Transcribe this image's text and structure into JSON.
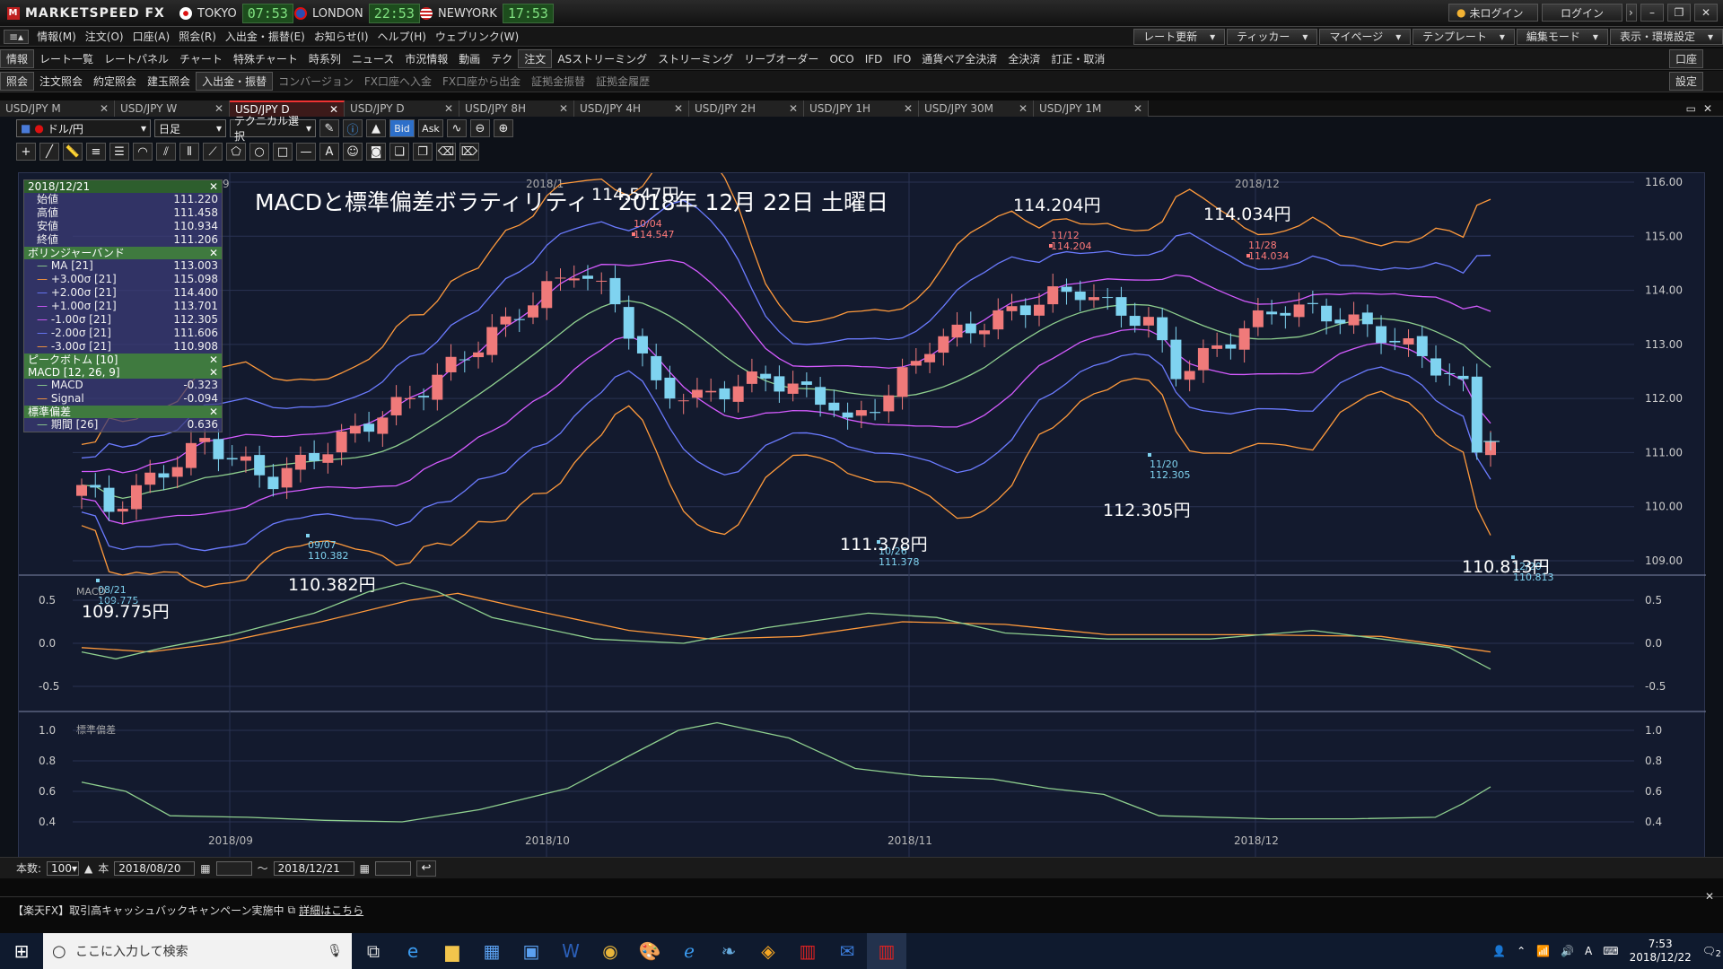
{
  "app": {
    "name": "MARKETSPEED FX",
    "login_status": "未ログイン",
    "login_button": "ログイン"
  },
  "clocks": [
    {
      "city": "TOKYO",
      "time": "07:53",
      "color": "#d11"
    },
    {
      "city": "LONDON",
      "time": "22:53",
      "color": "#2a4db3"
    },
    {
      "city": "NEWYORK",
      "time": "17:53",
      "color": "#3a5ac0"
    }
  ],
  "menu": [
    "情報(M)",
    "注文(O)",
    "口座(A)",
    "照会(R)",
    "入出金・振替(E)",
    "お知らせ(I)",
    "ヘルプ(H)",
    "ウェブリンク(W)"
  ],
  "menu_right": [
    "レート更新",
    "ティッカー",
    "マイページ",
    "テンプレート",
    "編集モード",
    "表示・環境設定"
  ],
  "toolbar1": [
    "情報",
    "レート一覧",
    "レートパネル",
    "チャート",
    "特殊チャート",
    "時系列",
    "ニュース",
    "市況情報",
    "動画",
    "テク",
    "注文",
    "ASストリーミング",
    "ストリーミング",
    "リーブオーダー",
    "OCO",
    "IFD",
    "IFO",
    "通貨ペア全決済",
    "全決済",
    "訂正・取消"
  ],
  "toolbar1_right": "口座",
  "toolbar2": [
    "照会",
    "注文照会",
    "約定照会",
    "建玉照会",
    "入出金・振替",
    "コンバージョン",
    "FX口座へ入金",
    "FX口座から出金",
    "証拠金振替",
    "証拠金履歴"
  ],
  "toolbar2_right": "設定",
  "tabs": [
    "USD/JPY M",
    "USD/JPY W",
    "USD/JPY D",
    "USD/JPY D",
    "USD/JPY 8H",
    "USD/JPY 4H",
    "USD/JPY 2H",
    "USD/JPY 1H",
    "USD/JPY 30M",
    "USD/JPY 1M"
  ],
  "chart_toolbar": {
    "pair": "ドル/円",
    "period": "日足",
    "tech": "テクニカル選択",
    "bid": "Bid",
    "ask": "Ask"
  },
  "legend": {
    "date": "2018/12/21",
    "ohlc": [
      {
        "k": "始値",
        "v": "111.220"
      },
      {
        "k": "高値",
        "v": "111.458"
      },
      {
        "k": "安値",
        "v": "110.934"
      },
      {
        "k": "終値",
        "v": "111.206"
      }
    ],
    "bb_title": "ボリンジャーバンド",
    "bb": [
      {
        "k": "MA [21]",
        "v": "113.003",
        "c": "#8fd08f"
      },
      {
        "k": "+3.00σ [21]",
        "v": "115.098",
        "c": "#ff9a3c"
      },
      {
        "k": "+2.00σ [21]",
        "v": "114.400",
        "c": "#6b7bff"
      },
      {
        "k": "+1.00σ [21]",
        "v": "113.701",
        "c": "#d45bff"
      },
      {
        "k": "-1.00σ [21]",
        "v": "112.305",
        "c": "#d45bff"
      },
      {
        "k": "-2.00σ [21]",
        "v": "111.606",
        "c": "#6b7bff"
      },
      {
        "k": "-3.00σ [21]",
        "v": "110.908",
        "c": "#ff9a3c"
      }
    ],
    "peak_title": "ピークボトム [10]",
    "macd_title": "MACD [12, 26, 9]",
    "macd": [
      {
        "k": "MACD",
        "v": "-0.323",
        "c": "#8fd08f"
      },
      {
        "k": "Signal",
        "v": "-0.094",
        "c": "#ff9a3c"
      }
    ],
    "sd_title": "標準偏差",
    "sd": [
      {
        "k": "期間 [26]",
        "v": "0.636",
        "c": "#8fd08f"
      }
    ]
  },
  "overlay_title": "MACDと標準偏差ボラティリティ　 2018年 12月 22日 土曜日",
  "chart_data": {
    "type": "candlestick",
    "symbol": "USD/JPY",
    "ylim": [
      109,
      116
    ],
    "yticks": [
      "116.00",
      "115.00",
      "114.00",
      "113.00",
      "112.00",
      "111.00",
      "110.00",
      "109.00"
    ],
    "xticks": [
      "2018/09",
      "2018/10",
      "2018/11",
      "2018/12"
    ],
    "top_month_labels": [
      "18/09",
      "2018/1",
      "2018/12"
    ],
    "annotations": [
      {
        "label": "109.775円",
        "date": "08/21",
        "price": "109.775",
        "kind": "low"
      },
      {
        "label": "110.382円",
        "date": "09/07",
        "price": "110.382",
        "kind": "low"
      },
      {
        "label": "114.547円",
        "date": "10/04",
        "price": "114.547",
        "kind": "high"
      },
      {
        "label": "111.378円",
        "date": "10/26",
        "price": "111.378",
        "kind": "low"
      },
      {
        "label": "114.204円",
        "date": "11/12",
        "price": "114.204",
        "kind": "high"
      },
      {
        "label": "112.305円",
        "date": "11/20",
        "price": "112.305",
        "kind": "low"
      },
      {
        "label": "114.034円",
        "date": "11/28",
        "price": "114.034",
        "kind": "high"
      },
      {
        "label": "110.813円",
        "date": "12/20",
        "price": "110.813",
        "kind": "low"
      }
    ],
    "macd_panel": {
      "label": "MACD",
      "yticks": [
        "0.5",
        "0.0",
        "-0.5"
      ]
    },
    "sd_panel": {
      "label": "標準偏差",
      "yticks": [
        "1.0",
        "0.8",
        "0.6",
        "0.4"
      ]
    },
    "colors": {
      "up": "#f07a7a",
      "down": "#7fd3f0",
      "ma": "#8fd08f",
      "s1": "#d45bff",
      "s2": "#6b7bff",
      "s3": "#ff9a3c"
    }
  },
  "status": {
    "count_label": "本数:",
    "count": "100",
    "unit": "本",
    "from": "2018/08/20",
    "to": "2018/12/21",
    "tilde": "～"
  },
  "banner": {
    "text": "【楽天FX】取引高キャッシュバックキャンペーン実施中",
    "link": "詳細はこちら"
  },
  "taskbar": {
    "search_placeholder": "ここに入力して検索",
    "time": "7:53",
    "date": "2018/12/22",
    "ime": "A",
    "badge": "2"
  }
}
